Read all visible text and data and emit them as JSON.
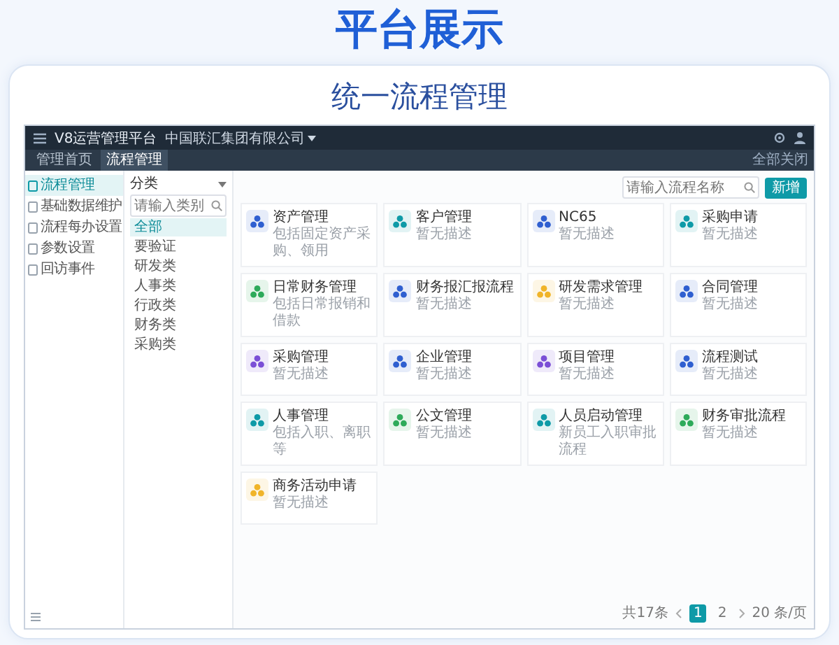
{
  "heading": "平台展示",
  "section_title": "统一流程管理",
  "app": {
    "brand": "V8运营管理平台",
    "company": "中国联汇集团有限公司",
    "tabs": [
      {
        "label": "管理首页",
        "selected": false
      },
      {
        "label": "流程管理",
        "selected": true
      }
    ],
    "close_all": "全部关闭",
    "menu": [
      {
        "label": "流程管理",
        "selected": true
      },
      {
        "label": "基础数据维护",
        "selected": false
      },
      {
        "label": "流程每办设置",
        "selected": false
      },
      {
        "label": "参数设置",
        "selected": false
      },
      {
        "label": "回访事件",
        "selected": false
      }
    ],
    "category": {
      "title": "分类",
      "search_placeholder": "请输入类别",
      "items": [
        {
          "label": "全部",
          "selected": true
        },
        {
          "label": "要验证",
          "selected": false
        },
        {
          "label": "研发类",
          "selected": false
        },
        {
          "label": "人事类",
          "selected": false
        },
        {
          "label": "行政类",
          "selected": false
        },
        {
          "label": "财务类",
          "selected": false
        },
        {
          "label": "采购类",
          "selected": false
        }
      ]
    },
    "search_placeholder": "请输入流程名称",
    "add_button": "新增",
    "cards": [
      {
        "title": "资产管理",
        "description": "包括固定资产采购、领用",
        "color": "#2f5fd0"
      },
      {
        "title": "客户管理",
        "description": "暂无描述",
        "color": "#0e9aa7"
      },
      {
        "title": "NC65",
        "description": "暂无描述",
        "color": "#2f5fd0"
      },
      {
        "title": "采购申请",
        "description": "暂无描述",
        "color": "#0e9aa7"
      },
      {
        "title": "日常财务管理",
        "description": "包括日常报销和借款",
        "color": "#2eaa5a"
      },
      {
        "title": "财务报汇报流程",
        "description": "暂无描述",
        "color": "#2f5fd0"
      },
      {
        "title": "研发需求管理",
        "description": "暂无描述",
        "color": "#f0b429"
      },
      {
        "title": "合同管理",
        "description": "暂无描述",
        "color": "#2f5fd0"
      },
      {
        "title": "采购管理",
        "description": "暂无描述",
        "color": "#7b4fd6"
      },
      {
        "title": "企业管理",
        "description": "暂无描述",
        "color": "#2f5fd0"
      },
      {
        "title": "项目管理",
        "description": "暂无描述",
        "color": "#7b4fd6"
      },
      {
        "title": "流程测试",
        "description": "暂无描述",
        "color": "#2f5fd0"
      },
      {
        "title": "人事管理",
        "description": "包括入职、离职等",
        "color": "#0e9aa7"
      },
      {
        "title": "公文管理",
        "description": "暂无描述",
        "color": "#2eaa5a"
      },
      {
        "title": "人员启动管理",
        "description": "新员工入职审批流程",
        "color": "#0e9aa7"
      },
      {
        "title": "财务审批流程",
        "description": "暂无描述",
        "color": "#2eaa5a"
      },
      {
        "title": "商务活动申请",
        "description": "暂无描述",
        "color": "#f0b429"
      }
    ],
    "pagination": {
      "total": "共17条",
      "pages": [
        {
          "label": "1",
          "selected": true
        },
        {
          "label": "2",
          "selected": false
        }
      ],
      "page_size": "20 条/页"
    }
  }
}
